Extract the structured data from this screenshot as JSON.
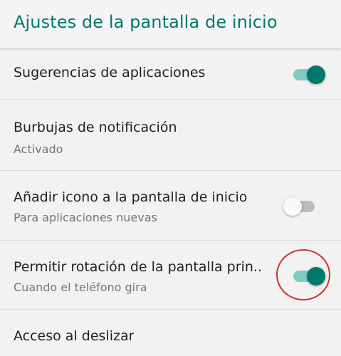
{
  "header": {
    "title": "Ajustes de la pantalla de inicio"
  },
  "settings": [
    {
      "title": "Sugerencias de aplicaciones",
      "subtitle": "",
      "toggle": "on"
    },
    {
      "title": "Burbujas de notificación",
      "subtitle": "Activado",
      "toggle": "none"
    },
    {
      "title": "Añadir icono a la pantalla de inicio",
      "subtitle": "Para aplicaciones nuevas",
      "toggle": "off"
    },
    {
      "title": "Permitir rotación de la pantalla prin..",
      "subtitle": "Cuando el teléfono gira",
      "toggle": "on"
    },
    {
      "title": "Acceso al deslizar",
      "subtitle": "",
      "toggle": "none"
    }
  ],
  "colors": {
    "accent": "#00796b",
    "toggle_track_on": "#80cbc4",
    "annotation": "#d32f2f"
  }
}
